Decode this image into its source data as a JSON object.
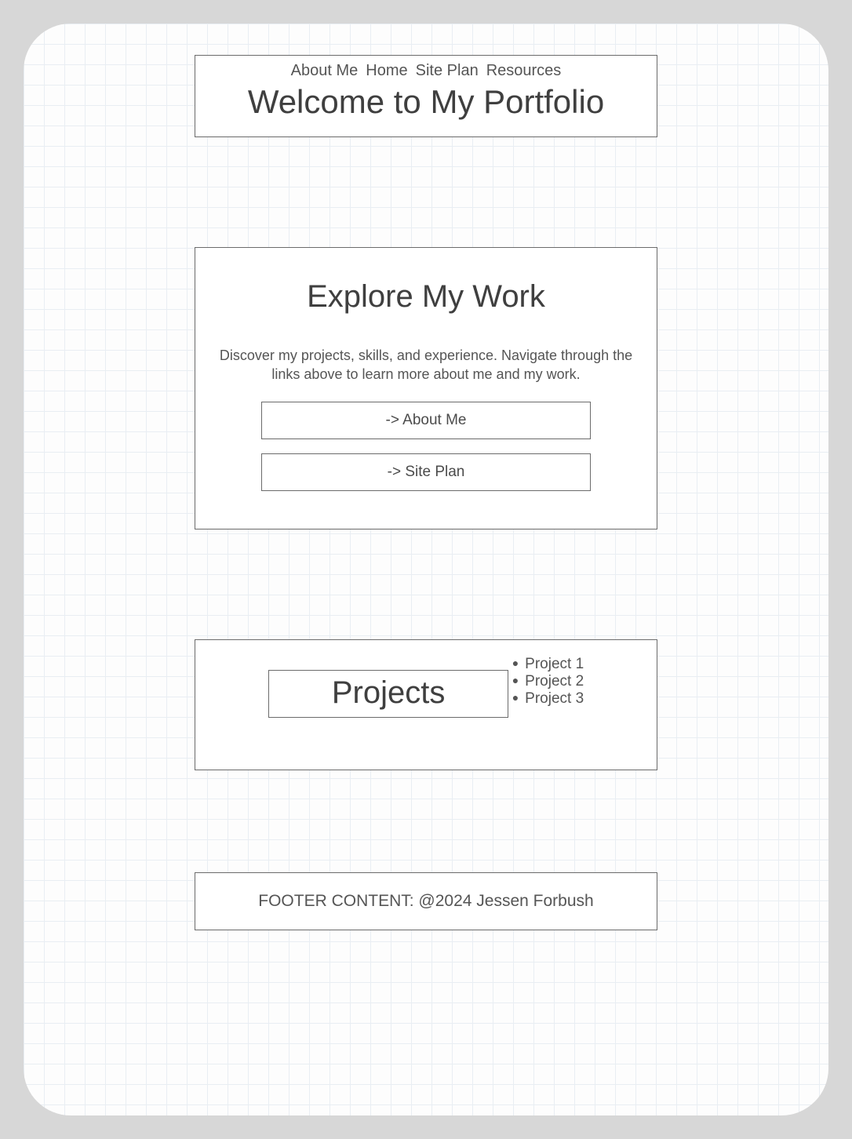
{
  "nav": {
    "about": "About Me",
    "home": "Home",
    "siteplan": "Site Plan",
    "resources": "Resources"
  },
  "header": {
    "title": "Welcome to My Portfolio"
  },
  "explore": {
    "title": "Explore My Work",
    "desc": "Discover my projects, skills, and experience. Navigate through the links above to learn more about me and my work.",
    "btn_about": "-> About Me",
    "btn_siteplan": "-> Site Plan"
  },
  "projects": {
    "title": "Projects",
    "items": [
      "Project 1",
      "Project 2",
      "Project 3"
    ]
  },
  "footer": {
    "text": "FOOTER CONTENT: @2024 Jessen Forbush"
  }
}
